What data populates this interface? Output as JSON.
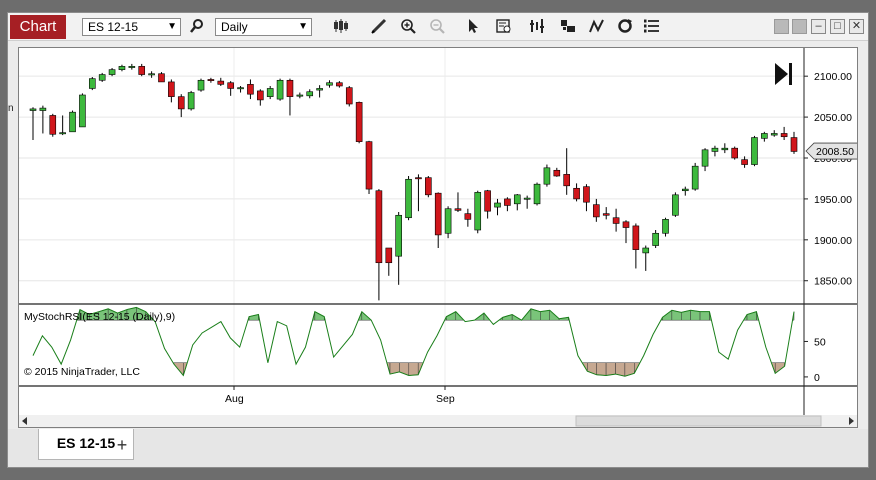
{
  "window": {
    "title": "Chart",
    "instrument": "ES 12-15",
    "interval": "Daily"
  },
  "icons": {
    "search": "search-icon",
    "bar_type": "bar-type-icon",
    "draw": "pencil-icon",
    "zoom_in": "zoom-in-icon",
    "zoom_out": "zoom-out-icon",
    "select": "pointer-icon",
    "data_box": "data-box-icon",
    "indicators": "indicators-icon",
    "strategies": "strategies-icon",
    "chart_trader": "chart-trader-icon",
    "reload": "reload-icon",
    "properties": "properties-icon"
  },
  "window_controls": [
    "minimize",
    "maximize",
    "close"
  ],
  "tabs": [
    {
      "label": "ES 12-15"
    }
  ],
  "add_tab_label": "+",
  "cutoff_text": "n",
  "colors": {
    "up": "#3db93d",
    "down": "#d0161b",
    "brand": "#a61f24",
    "indicator_line": "#1a7f1a",
    "overbought_fill": "#7ac47a",
    "oversold_fill": "#c6a891"
  },
  "chart_data": [
    {
      "type": "candlestick",
      "title": "",
      "x_ticks": [
        "Aug",
        "Sep"
      ],
      "y_ticks": [
        "2100.00",
        "2050.00",
        "2000.00",
        "1950.00",
        "1900.00",
        "1850.00"
      ],
      "ylim": [
        1824,
        2132
      ],
      "last_price": "2008.50",
      "candles": [
        [
          2058,
          2060,
          2022,
          2062
        ],
        [
          2058,
          2061,
          2030,
          2064
        ],
        [
          2052,
          2029,
          2026,
          2054
        ],
        [
          2030,
          2031,
          2028,
          2052
        ],
        [
          2032,
          2056,
          2032,
          2058
        ],
        [
          2038,
          2077,
          2038,
          2079
        ],
        [
          2085,
          2097,
          2083,
          2099
        ],
        [
          2095,
          2102,
          2093,
          2104
        ],
        [
          2102,
          2108,
          2100,
          2110
        ],
        [
          2108,
          2112,
          2106,
          2114
        ],
        [
          2112,
          2112,
          2108,
          2115
        ],
        [
          2112,
          2102,
          2100,
          2115
        ],
        [
          2103,
          2103,
          2098,
          2106
        ],
        [
          2103,
          2093,
          2093,
          2105
        ],
        [
          2093,
          2075,
          2068,
          2096
        ],
        [
          2075,
          2060,
          2050,
          2078
        ],
        [
          2060,
          2080,
          2058,
          2082
        ],
        [
          2083,
          2095,
          2081,
          2097
        ],
        [
          2096,
          2095,
          2092,
          2098
        ],
        [
          2094,
          2090,
          2088,
          2098
        ],
        [
          2092,
          2085,
          2076,
          2094
        ],
        [
          2085,
          2086,
          2080,
          2088
        ],
        [
          2090,
          2078,
          2072,
          2096
        ],
        [
          2082,
          2071,
          2064,
          2084
        ],
        [
          2075,
          2085,
          2072,
          2088
        ],
        [
          2072,
          2095,
          2070,
          2097
        ],
        [
          2095,
          2075,
          2052,
          2097
        ],
        [
          2076,
          2077,
          2073,
          2080
        ],
        [
          2076,
          2081,
          2073,
          2084
        ],
        [
          2083,
          2085,
          2074,
          2089
        ],
        [
          2089,
          2092,
          2086,
          2095
        ],
        [
          2092,
          2088,
          2086,
          2094
        ],
        [
          2086,
          2066,
          2063,
          2088
        ],
        [
          2068,
          2020,
          2018,
          2069
        ],
        [
          2020,
          1962,
          1956,
          2021
        ],
        [
          1960,
          1872,
          1826,
          1962
        ],
        [
          1890,
          1872,
          1856,
          1890
        ],
        [
          1880,
          1930,
          1845,
          1934
        ],
        [
          1927,
          1974,
          1924,
          1978
        ],
        [
          1976,
          1975,
          1935,
          1980
        ],
        [
          1976,
          1955,
          1952,
          1978
        ],
        [
          1957,
          1906,
          1890,
          1958
        ],
        [
          1908,
          1938,
          1902,
          1941
        ],
        [
          1938,
          1936,
          1934,
          1958
        ],
        [
          1932,
          1925,
          1916,
          1938
        ],
        [
          1912,
          1958,
          1908,
          1960
        ],
        [
          1960,
          1935,
          1926,
          1961
        ],
        [
          1940,
          1945,
          1930,
          1950
        ],
        [
          1950,
          1942,
          1935,
          1952
        ],
        [
          1944,
          1955,
          1936,
          1956
        ],
        [
          1950,
          1951,
          1938,
          1954
        ],
        [
          1944,
          1968,
          1942,
          1970
        ],
        [
          1968,
          1988,
          1965,
          1992
        ],
        [
          1985,
          1978,
          1977,
          1988
        ],
        [
          1980,
          1966,
          1955,
          2012
        ],
        [
          1963,
          1950,
          1947,
          1969
        ],
        [
          1965,
          1946,
          1935,
          1968
        ],
        [
          1943,
          1928,
          1922,
          1950
        ],
        [
          1932,
          1930,
          1925,
          1940
        ],
        [
          1927,
          1920,
          1910,
          1938
        ],
        [
          1922,
          1915,
          1896,
          1924
        ],
        [
          1917,
          1888,
          1865,
          1920
        ],
        [
          1884,
          1890,
          1862,
          1893
        ],
        [
          1893,
          1908,
          1890,
          1912
        ],
        [
          1908,
          1925,
          1904,
          1927
        ],
        [
          1930,
          1955,
          1928,
          1958
        ],
        [
          1960,
          1962,
          1954,
          1965
        ],
        [
          1962,
          1990,
          1960,
          1994
        ],
        [
          1990,
          2010,
          1984,
          2012
        ],
        [
          2008,
          2012,
          2002,
          2015
        ],
        [
          2010,
          2012,
          2006,
          2018
        ],
        [
          2012,
          2000,
          1998,
          2014
        ],
        [
          1998,
          1992,
          1988,
          2002
        ],
        [
          1992,
          2025,
          1990,
          2027
        ],
        [
          2024,
          2030,
          2020,
          2032
        ],
        [
          2028,
          2030,
          2026,
          2034
        ],
        [
          2030,
          2026,
          2022,
          2038
        ],
        [
          2025,
          2008,
          2005,
          2032
        ]
      ]
    },
    {
      "type": "line",
      "title": "MyStochRSI(ES 12-15 (Daily),9)",
      "y_ticks": [
        "50",
        "0"
      ],
      "ylim": [
        -10,
        100
      ],
      "copyright": "© 2015 NinjaTrader, LLC",
      "overbought": 80,
      "oversold": 20,
      "values": [
        30,
        58,
        42,
        18,
        52,
        95,
        88,
        92,
        96,
        90,
        95,
        98,
        92,
        78,
        40,
        18,
        2,
        45,
        62,
        70,
        78,
        55,
        42,
        85,
        88,
        20,
        78,
        72,
        18,
        42,
        92,
        85,
        28,
        44,
        60,
        92,
        80,
        52,
        4,
        7,
        2,
        3,
        35,
        58,
        85,
        92,
        78,
        80,
        90,
        74,
        84,
        88,
        80,
        96,
        92,
        94,
        82,
        84,
        30,
        8,
        3,
        2,
        4,
        1,
        5,
        30,
        60,
        84,
        94,
        91,
        94,
        92,
        92,
        35,
        25,
        66,
        88,
        92,
        42,
        5,
        15,
        92
      ]
    }
  ]
}
